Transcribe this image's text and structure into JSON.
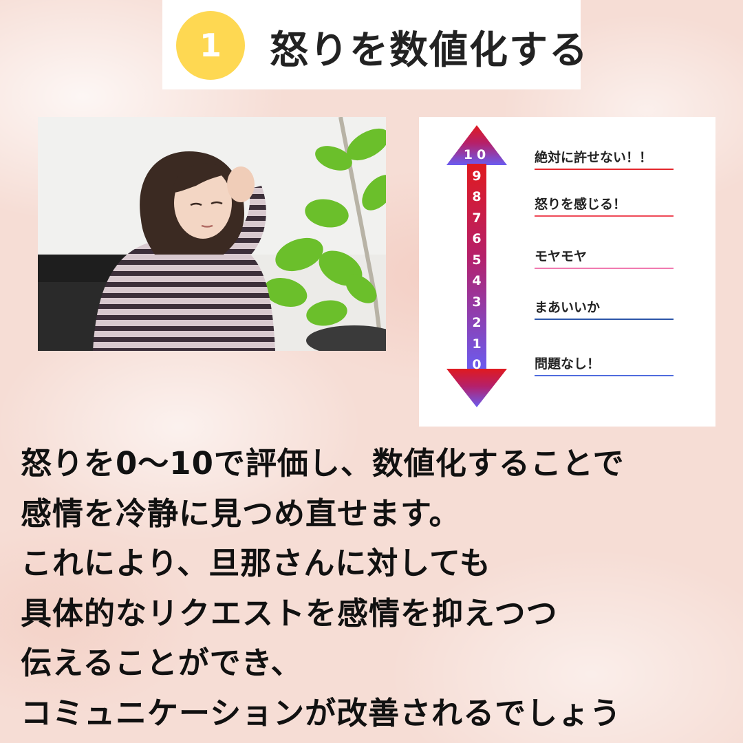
{
  "title": {
    "number": "1",
    "text": "怒りを数値化する",
    "badge_color": "#fed852"
  },
  "scale": {
    "numbers": [
      "10",
      "9",
      "8",
      "7",
      "6",
      "5",
      "4",
      "3",
      "2",
      "1",
      "0"
    ],
    "gradient_top_color": "#e01a1f",
    "gradient_bottom_color": "#6a5cf0",
    "levels": [
      {
        "label": "絶対に許せない！！",
        "color": "#e3272d"
      },
      {
        "label": "怒りを感じる！",
        "color": "#ee4a58"
      },
      {
        "label": "モヤモヤ",
        "color": "#f07ab0"
      },
      {
        "label": "まあいいか",
        "color": "#2c56a8"
      },
      {
        "label": "問題なし！",
        "color": "#4f6cde"
      }
    ]
  },
  "body_lines": [
    "怒りを0〜10で評価し、数値化することで",
    "感情を冷静に見つめ直せます。",
    "これにより、旦那さんに対しても",
    "具体的なリクエストを感情を抑えつつ",
    "伝えることができ、",
    "コミュニケーションが改善されるでしょう"
  ]
}
